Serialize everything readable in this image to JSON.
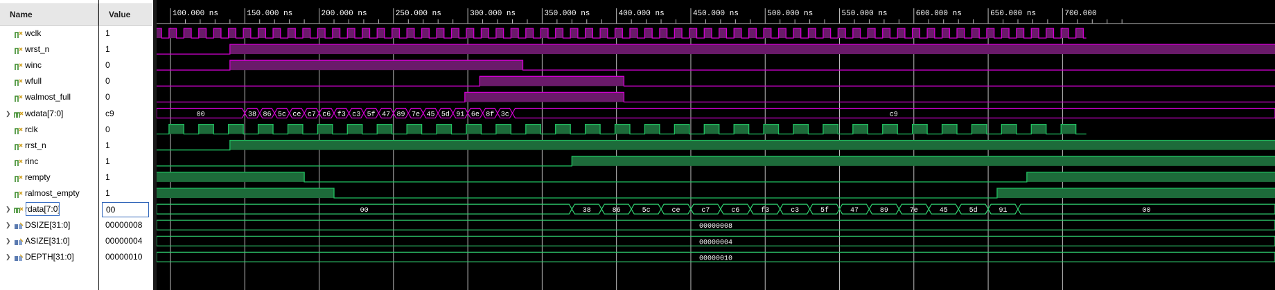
{
  "headers": {
    "name": "Name",
    "value": "Value"
  },
  "ruler": {
    "labels": [
      "100.000 ns",
      "150.000 ns",
      "200.000 ns",
      "250.000 ns",
      "300.000 ns",
      "350.000 ns",
      "400.000 ns",
      "450.000 ns",
      "500.000 ns",
      "550.000 ns",
      "600.000 ns",
      "650.000 ns",
      "700.000"
    ]
  },
  "signals": [
    {
      "name": "wclk",
      "value": "1",
      "icon": "bit-signal-icon",
      "expandable": false
    },
    {
      "name": "wrst_n",
      "value": "1",
      "icon": "bit-signal-icon",
      "expandable": false
    },
    {
      "name": "winc",
      "value": "0",
      "icon": "bit-signal-icon",
      "expandable": false
    },
    {
      "name": "wfull",
      "value": "0",
      "icon": "bit-signal-icon",
      "expandable": false
    },
    {
      "name": "walmost_full",
      "value": "0",
      "icon": "bit-signal-icon",
      "expandable": false
    },
    {
      "name": "wdata[7:0]",
      "value": "c9",
      "icon": "bus-signal-icon",
      "expandable": true
    },
    {
      "name": "rclk",
      "value": "0",
      "icon": "bit-signal-icon",
      "expandable": false
    },
    {
      "name": "rrst_n",
      "value": "1",
      "icon": "bit-signal-icon",
      "expandable": false
    },
    {
      "name": "rinc",
      "value": "1",
      "icon": "bit-signal-icon",
      "expandable": false
    },
    {
      "name": "rempty",
      "value": "1",
      "icon": "bit-signal-icon",
      "expandable": false
    },
    {
      "name": "ralmost_empty",
      "value": "1",
      "icon": "bit-signal-icon",
      "expandable": false
    },
    {
      "name": "rdata[7:0]",
      "value": "00",
      "icon": "bus-signal-icon",
      "expandable": true,
      "selected": true
    },
    {
      "name": "DSIZE[31:0]",
      "value": "00000008",
      "icon": "parameter-icon",
      "expandable": true
    },
    {
      "name": "ASIZE[31:0]",
      "value": "00000004",
      "icon": "parameter-icon",
      "expandable": true
    },
    {
      "name": "DEPTH[31:0]",
      "value": "00000010",
      "icon": "parameter-icon",
      "expandable": true
    }
  ],
  "colors": {
    "write_domain": "#d000d0",
    "write_fill": "#6a1a6a",
    "read_domain": "#20c060",
    "read_fill": "#1d6b3a",
    "bus": "#30d070",
    "grid": "#bdbdbd",
    "text": "#ffffff"
  },
  "wave_labels": {
    "wdata_initial": "00",
    "wdata_sequence": [
      "38",
      "86",
      "5c",
      "ce",
      "c7",
      "c6",
      "f3",
      "c3",
      "5f",
      "47",
      "89",
      "7e",
      "45",
      "5d",
      "91",
      "6e",
      "8f",
      "3c"
    ],
    "wdata_final": "c9",
    "rdata_initial": "00",
    "rdata_sequence": [
      "38",
      "86",
      "5c",
      "ce",
      "c7",
      "c6",
      "f3",
      "c3",
      "5f",
      "47",
      "89",
      "7e",
      "45",
      "5d",
      "91"
    ],
    "rdata_final": "00",
    "dsize": "00000008",
    "asize": "00000004",
    "depth": "00000010"
  }
}
